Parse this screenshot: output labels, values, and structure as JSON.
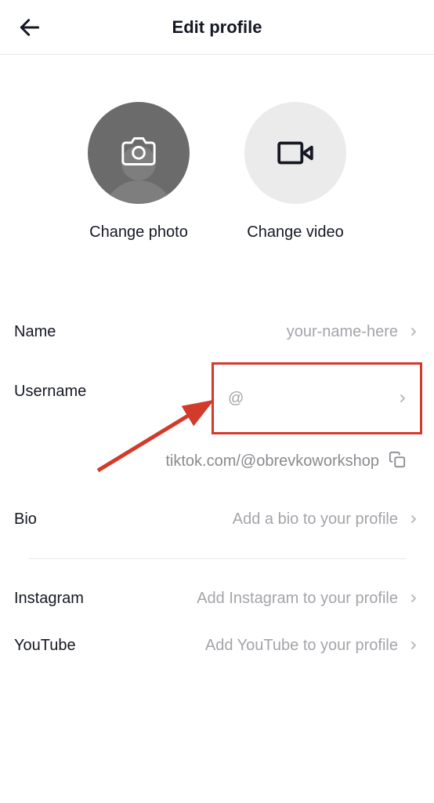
{
  "header": {
    "title": "Edit profile"
  },
  "media": {
    "change_photo_label": "Change photo",
    "change_video_label": "Change video"
  },
  "fields": {
    "name": {
      "label": "Name",
      "value": "your-name-here"
    },
    "username": {
      "label": "Username",
      "value": "@"
    },
    "profile_link": "tiktok.com/@obrevkoworkshop",
    "bio": {
      "label": "Bio",
      "placeholder": "Add a bio to your profile"
    },
    "instagram": {
      "label": "Instagram",
      "placeholder": "Add Instagram to your profile"
    },
    "youtube": {
      "label": "YouTube",
      "placeholder": "Add YouTube to your profile"
    }
  }
}
